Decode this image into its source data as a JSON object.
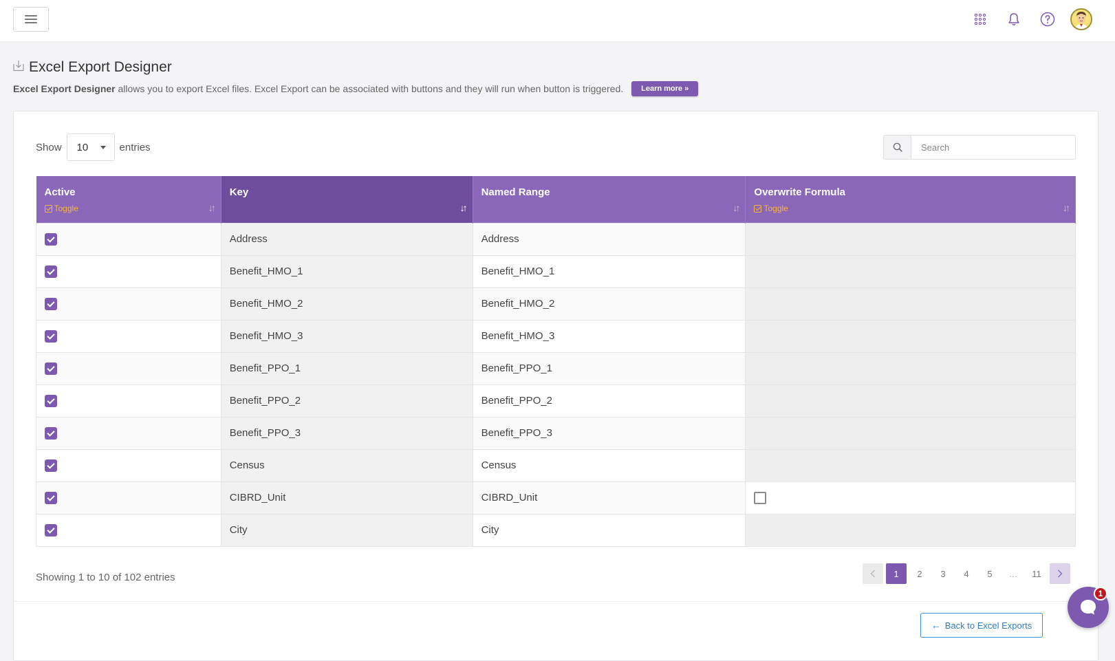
{
  "topbar": {
    "icons": [
      "menu-icon",
      "apps-grid-icon",
      "bell-icon",
      "help-icon",
      "avatar"
    ]
  },
  "page": {
    "title": "Excel Export Designer",
    "desc_bold": "Excel Export Designer",
    "desc_rest": " allows you to export Excel files. Excel Export can be associated with buttons and they will run when button is triggered.",
    "learn_more": "Learn more »"
  },
  "controls": {
    "show_label": "Show",
    "entries_label": "entries",
    "page_length": "10",
    "search_placeholder": "Search"
  },
  "table": {
    "headers": [
      {
        "label": "Active",
        "toggle": "Toggle"
      },
      {
        "label": "Key"
      },
      {
        "label": "Named Range"
      },
      {
        "label": "Overwrite Formula",
        "toggle": "Toggle"
      }
    ],
    "rows": [
      {
        "active": true,
        "key": "Address",
        "named_range": "Address",
        "overwrite": null
      },
      {
        "active": true,
        "key": "Benefit_HMO_1",
        "named_range": "Benefit_HMO_1",
        "overwrite": null
      },
      {
        "active": true,
        "key": "Benefit_HMO_2",
        "named_range": "Benefit_HMO_2",
        "overwrite": null
      },
      {
        "active": true,
        "key": "Benefit_HMO_3",
        "named_range": "Benefit_HMO_3",
        "overwrite": null
      },
      {
        "active": true,
        "key": "Benefit_PPO_1",
        "named_range": "Benefit_PPO_1",
        "overwrite": null
      },
      {
        "active": true,
        "key": "Benefit_PPO_2",
        "named_range": "Benefit_PPO_2",
        "overwrite": null
      },
      {
        "active": true,
        "key": "Benefit_PPO_3",
        "named_range": "Benefit_PPO_3",
        "overwrite": null
      },
      {
        "active": true,
        "key": "Census",
        "named_range": "Census",
        "overwrite": null
      },
      {
        "active": true,
        "key": "CIBRD_Unit",
        "named_range": "CIBRD_Unit",
        "overwrite": false
      },
      {
        "active": true,
        "key": "City",
        "named_range": "City",
        "overwrite": null
      }
    ]
  },
  "footer": {
    "info": "Showing 1 to 10 of 102 entries",
    "pages": [
      "1",
      "2",
      "3",
      "4",
      "5",
      "…",
      "11"
    ],
    "current_page": "1",
    "back_button": "Back to Excel Exports"
  },
  "chat": {
    "badge": "1"
  },
  "colors": {
    "accent": "#7d5ab0",
    "header": "#8a67b8",
    "header_sorted": "#6e4d9e",
    "toggle": "#f5b544",
    "link_blue": "#2f7fc8",
    "badge_red": "#c0171d"
  }
}
